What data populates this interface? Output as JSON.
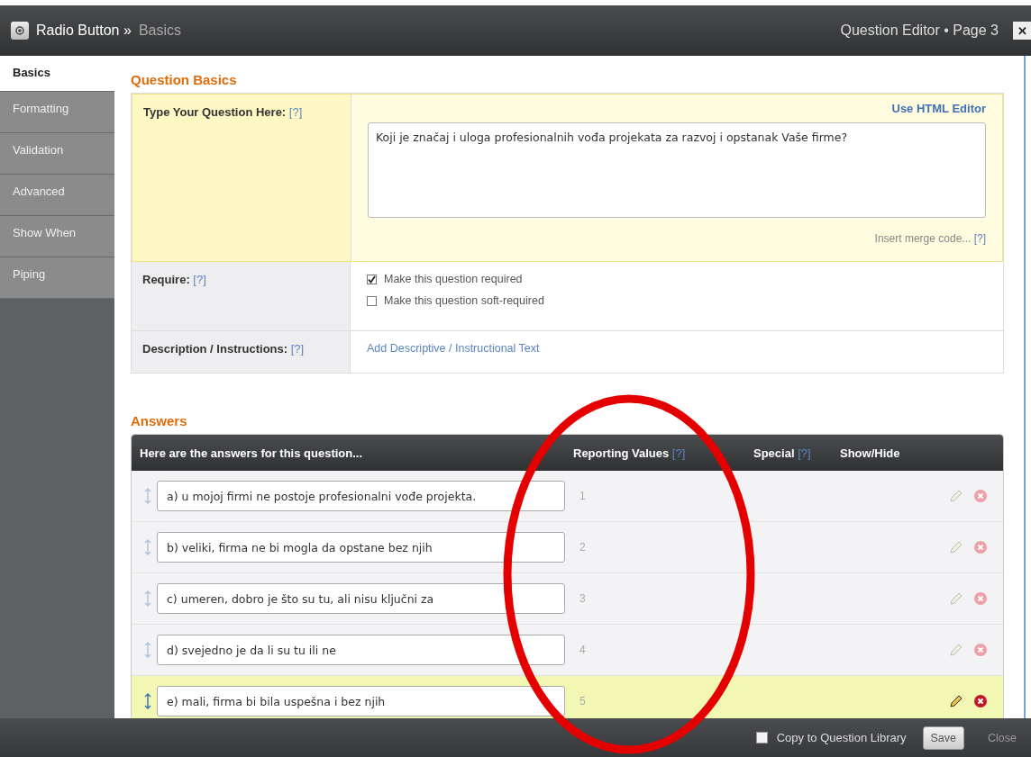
{
  "window": {
    "title": "Radio Button",
    "separator": "»",
    "subtitle": "Basics",
    "right_title": "Question Editor • Page 3",
    "close": "✕"
  },
  "sidebar": {
    "items": [
      {
        "label": "Basics",
        "selected": true
      },
      {
        "label": "Formatting",
        "selected": false
      },
      {
        "label": "Validation",
        "selected": false
      },
      {
        "label": "Advanced",
        "selected": false
      },
      {
        "label": "Show When",
        "selected": false
      },
      {
        "label": "Piping",
        "selected": false
      }
    ]
  },
  "question_basics": {
    "heading": "Question Basics",
    "question": {
      "label": "Type Your Question Here:",
      "help": "[?]",
      "link": "Use HTML Editor",
      "value": "Koji je značaj i uloga profesionalnih vođa projekata za razvoj i opstanak Vaše firme?",
      "merge": "Insert merge code...",
      "merge_help": "[?]"
    },
    "require": {
      "label": "Require:",
      "help": "[?]",
      "options": [
        {
          "label": "Make this question required",
          "checked": true
        },
        {
          "label": "Make this question soft-required",
          "checked": false
        }
      ]
    },
    "description": {
      "label": "Description / Instructions:",
      "help": "[?]",
      "link": "Add Descriptive / Instructional Text"
    }
  },
  "answers": {
    "heading": "Answers",
    "columns": [
      {
        "label": "Here are the answers for this question..."
      },
      {
        "label": "Reporting Values",
        "help": "[?]"
      },
      {
        "label": "Special",
        "help": "[?]"
      },
      {
        "label": "Show/Hide"
      }
    ],
    "rows": [
      {
        "text": "a) u mojoj firmi ne postoje profesionalni vođe projekta.",
        "value": "1",
        "selected": false
      },
      {
        "text": "b) veliki, firma ne bi mogla da opstane bez njih",
        "value": "2",
        "selected": false
      },
      {
        "text": "c) umeren, dobro je što su tu, ali nisu ključni za",
        "value": "3",
        "selected": false
      },
      {
        "text": "d) svejedno je da li su tu ili ne",
        "value": "4",
        "selected": false
      },
      {
        "text": "e) mali, firma bi bila uspešna i bez njih",
        "value": "5",
        "selected": true
      }
    ]
  },
  "footer": {
    "copy": {
      "label": "Copy to Question Library",
      "checked": false
    },
    "save": "Save",
    "close": "Close"
  },
  "annotation": {
    "kind": "ellipse"
  }
}
